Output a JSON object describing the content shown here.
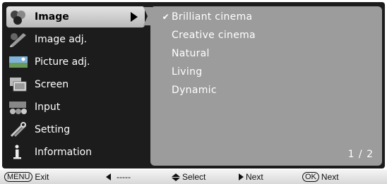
{
  "menu": {
    "items": [
      {
        "label": "Image",
        "icon": "image-icon",
        "selected": true
      },
      {
        "label": "Image adj.",
        "icon": "image-adj-icon",
        "selected": false
      },
      {
        "label": "Picture adj.",
        "icon": "picture-adj-icon",
        "selected": false
      },
      {
        "label": "Screen",
        "icon": "screen-icon",
        "selected": false
      },
      {
        "label": "Input",
        "icon": "input-icon",
        "selected": false
      },
      {
        "label": "Setting",
        "icon": "setting-icon",
        "selected": false
      },
      {
        "label": "Information",
        "icon": "information-icon",
        "selected": false
      }
    ]
  },
  "submenu": {
    "options": [
      {
        "label": "Brilliant cinema",
        "checked": true
      },
      {
        "label": "Creative cinema",
        "checked": false
      },
      {
        "label": "Natural",
        "checked": false
      },
      {
        "label": "Living",
        "checked": false
      },
      {
        "label": "Dynamic",
        "checked": false
      }
    ],
    "check_mark": "✔",
    "page": "1 / 2"
  },
  "footer": {
    "menu_key": "MENU",
    "exit": "Exit",
    "back": "-----",
    "select": "Select",
    "next": "Next",
    "ok_key": "OK",
    "ok_next": "Next"
  },
  "colors": {
    "frame": "#1c1c1c",
    "panel": "#9c9c9c",
    "selected_item": "#d0d0d0"
  }
}
